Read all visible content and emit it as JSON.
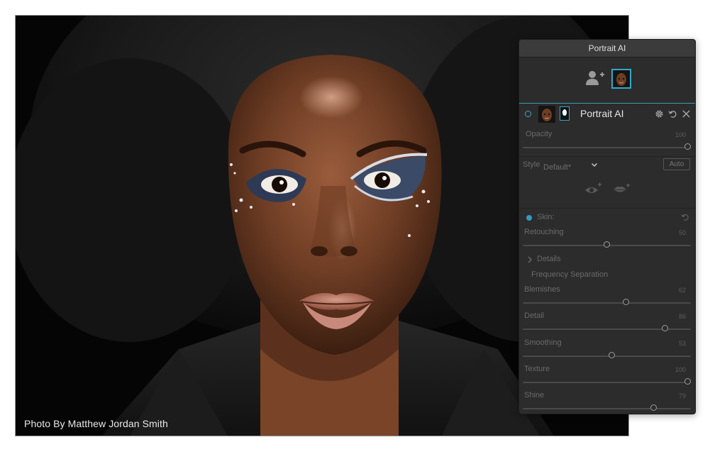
{
  "photo": {
    "credit": "Photo By Matthew Jordan Smith"
  },
  "panel": {
    "title": "Portrait AI",
    "layer": {
      "name": "Portrait AI",
      "opacity_label": "Opacity",
      "opacity_value": "100",
      "opacity": 100
    },
    "style": {
      "label": "Style",
      "value": "Default*",
      "auto_label": "Auto"
    },
    "skin": {
      "label": "Skin:",
      "retouching_label": "Retouching",
      "retouching_value": "50",
      "retouching": 50,
      "details_label": "Details",
      "frequency_label": "Frequency Separation",
      "sliders": [
        {
          "label": "Blemishes",
          "value": "62",
          "level": 62
        },
        {
          "label": "Detail",
          "value": "86",
          "level": 86
        },
        {
          "label": "Smoothing",
          "value": "53",
          "level": 53
        },
        {
          "label": "Texture",
          "value": "100",
          "level": 100
        },
        {
          "label": "Shine",
          "value": "79",
          "level": 79
        }
      ]
    },
    "icons": {
      "add_user": "add-user-icon",
      "settings": "gear-icon",
      "reset": "undo-icon",
      "close": "close-icon",
      "eye": "eye-enhance-icon",
      "mouth": "lips-enhance-icon"
    },
    "colors": {
      "accent": "#37a8c7",
      "panel_bg": "#2c2c2c"
    }
  }
}
